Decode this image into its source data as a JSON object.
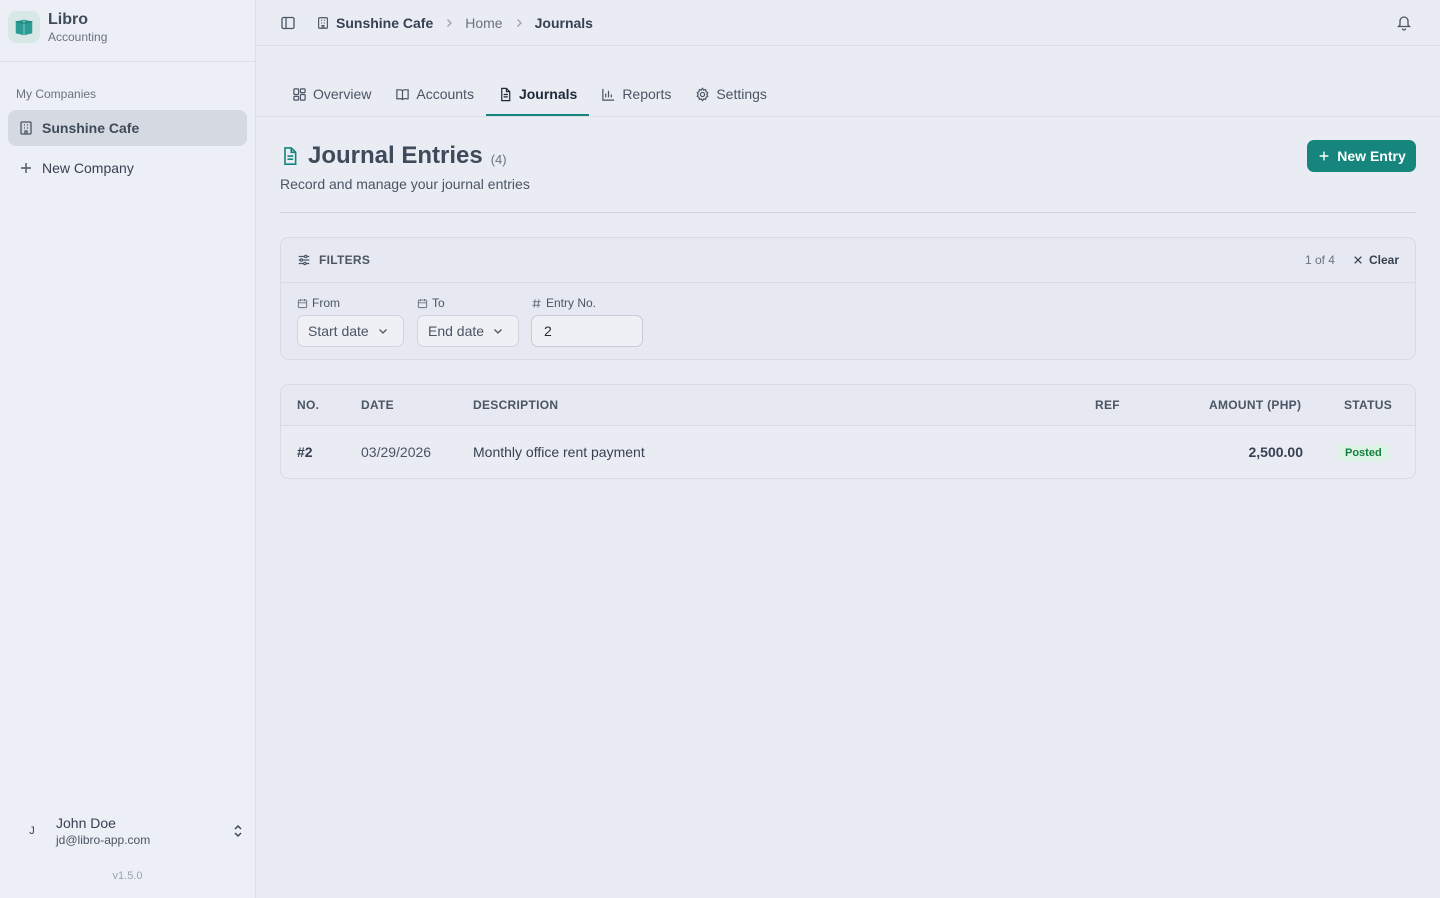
{
  "app": {
    "name": "Libro",
    "subtitle": "Accounting",
    "version": "v1.5.0"
  },
  "sidebar": {
    "section_label": "My Companies",
    "items": [
      {
        "label": "Sunshine Cafe",
        "active": true,
        "icon": "building-icon"
      },
      {
        "label": "New Company",
        "active": false,
        "icon": "plus-icon"
      }
    ]
  },
  "user": {
    "initial": "J",
    "name": "John Doe",
    "email": "jd@libro-app.com"
  },
  "breadcrumb": {
    "company": "Sunshine Cafe",
    "home": "Home",
    "current": "Journals"
  },
  "tabs": [
    {
      "label": "Overview",
      "icon": "grid-icon"
    },
    {
      "label": "Accounts",
      "icon": "book-icon"
    },
    {
      "label": "Journals",
      "icon": "document-icon",
      "active": true
    },
    {
      "label": "Reports",
      "icon": "bar-chart-icon"
    },
    {
      "label": "Settings",
      "icon": "gear-icon"
    }
  ],
  "page": {
    "title": "Journal Entries",
    "count": "(4)",
    "subtitle": "Record and manage your journal entries",
    "new_button": "New Entry"
  },
  "filters": {
    "title": "FILTERS",
    "count": "1 of 4",
    "clear_label": "Clear",
    "from_label": "From",
    "from_value": "Start date",
    "to_label": "To",
    "to_value": "End date",
    "entry_label": "Entry No.",
    "entry_value": "2"
  },
  "table": {
    "headers": {
      "no": "NO.",
      "date": "DATE",
      "description": "DESCRIPTION",
      "ref": "REF",
      "amount": "AMOUNT (PHP)",
      "status": "STATUS"
    },
    "rows": [
      {
        "no": "#2",
        "date": "03/29/2026",
        "description": "Monthly office rent payment",
        "ref": "",
        "amount": "2,500.00",
        "status": "Posted"
      }
    ]
  },
  "colors": {
    "accent": "#16857d",
    "posted_bg": "#dcf3e6",
    "posted_text": "#15803d"
  }
}
